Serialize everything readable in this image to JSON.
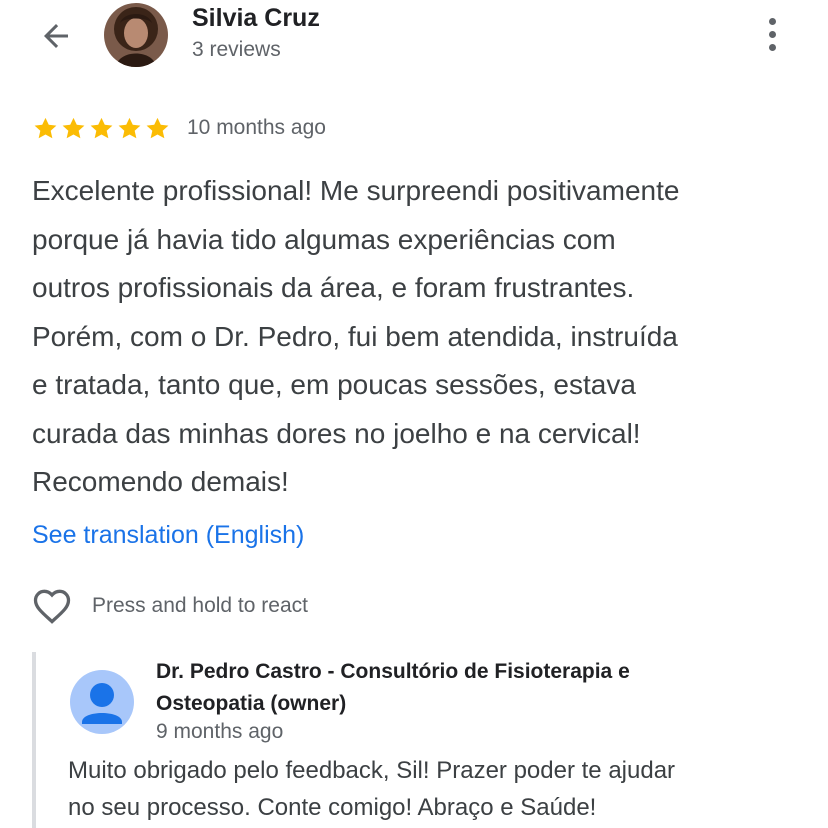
{
  "header": {
    "back_icon": "arrow-back-icon",
    "reviewer_name": "Silvia Cruz",
    "review_count": "3 reviews",
    "more_icon": "more-vert-icon"
  },
  "review": {
    "rating": 5,
    "rating_max": 5,
    "star_color": "#fbbc04",
    "time_ago": "10 months ago",
    "text": "Excelente profissional! Me surpreendi positivamente\nporque já havia tido algumas experiências com\noutros profissionais da área, e foram frustrantes.\nPorém, com o Dr. Pedro, fui bem atendida, instruída\ne tratada, tanto que, em poucas sessões, estava\ncurada das minhas dores no joelho e na cervical!\nRecomendo demais!",
    "translate_label": "See translation (English)",
    "react_icon": "heart-outline-icon",
    "react_label": "Press and hold to react"
  },
  "owner_reply": {
    "avatar_icon": "person-avatar-icon",
    "name": "Dr. Pedro Castro - Consultório de Fisioterapia e Osteopatia (owner)",
    "time_ago": "9 months ago",
    "text": "Muito obrigado pelo feedback, Sil! Prazer poder te ajudar\nno seu processo. Conte comigo! Abraço e Saúde!"
  },
  "colors": {
    "link": "#1a73e8",
    "star": "#fbbc04",
    "avatar_bg": "#a8c7fa",
    "avatar_fg": "#1a73e8"
  }
}
